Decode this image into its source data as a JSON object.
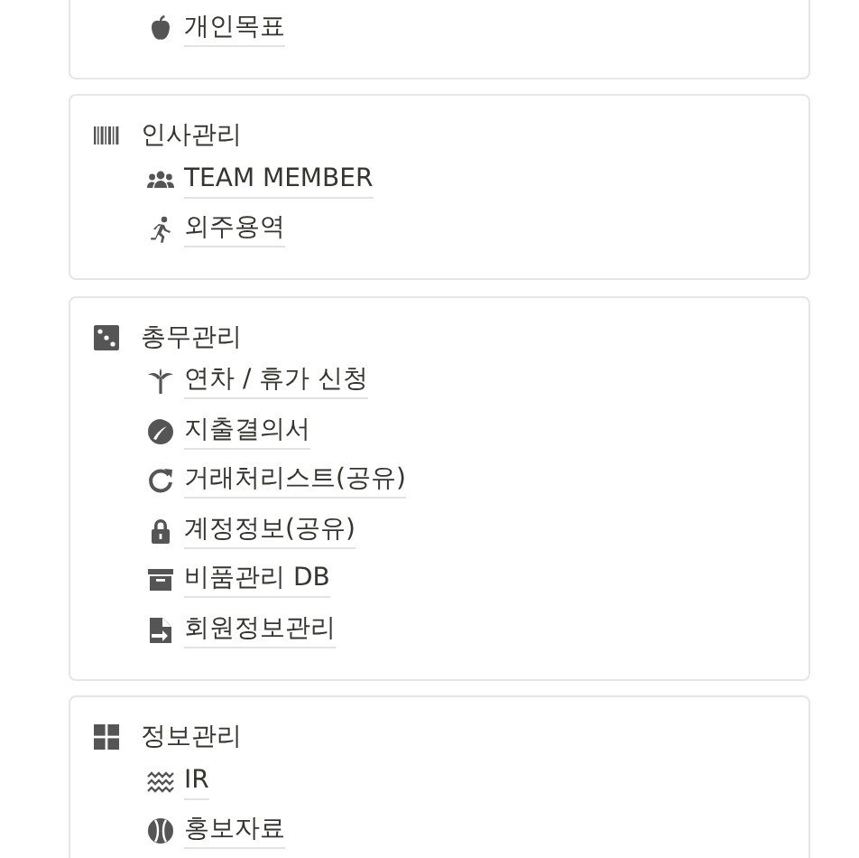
{
  "sections": [
    {
      "items": [
        {
          "label": "개인목표"
        }
      ]
    },
    {
      "heading": "인사관리",
      "items": [
        {
          "label": "TEAM MEMBER"
        },
        {
          "label": "외주용역"
        }
      ]
    },
    {
      "heading": "총무관리",
      "items": [
        {
          "label": "연차 / 휴가 신청"
        },
        {
          "label": "지출결의서"
        },
        {
          "label": "거래처리스트(공유)"
        },
        {
          "label": "계정정보(공유)"
        },
        {
          "label": "비품관리 DB"
        },
        {
          "label": "회원정보관리"
        }
      ]
    },
    {
      "heading": "정보관리",
      "items": [
        {
          "label": "IR"
        },
        {
          "label": "홍보자료"
        }
      ]
    }
  ]
}
